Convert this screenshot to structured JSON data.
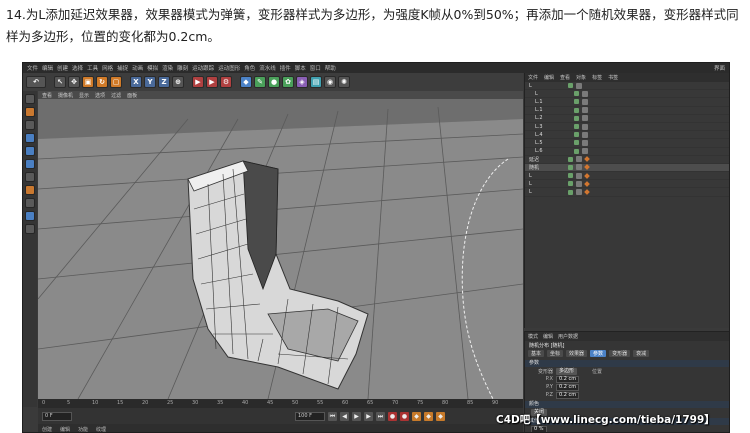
{
  "caption": "14.为L添加延迟效果器，效果器模式为弹簧，变形器样式为多边形，为强度K帧从0%到50%；再添加一个随机效果器，变形器样式同样为多边形，位置的变化都为0.2cm。",
  "menubar": {
    "items": [
      "文件",
      "编辑",
      "创建",
      "选择",
      "工具",
      "网格",
      "捕捉",
      "动画",
      "模拟",
      "渲染",
      "雕刻",
      "运动跟踪",
      "运动图形",
      "角色",
      "流水线",
      "插件",
      "脚本",
      "窗口",
      "帮助"
    ],
    "layout_label": "界面"
  },
  "toolbar": {
    "x_label": "X",
    "y_label": "Y",
    "z_label": "Z"
  },
  "viewport": {
    "menu": [
      "查看",
      "摄像机",
      "显示",
      "选项",
      "过滤",
      "面板"
    ]
  },
  "timeline": {
    "ticks": [
      "0",
      "5",
      "10",
      "15",
      "20",
      "25",
      "30",
      "35",
      "40",
      "45",
      "50",
      "55",
      "60",
      "65",
      "70",
      "75",
      "80",
      "85",
      "90"
    ],
    "start_frame": "0 F",
    "end_frame": "100 F",
    "material_menu": [
      "创建",
      "编辑",
      "功能",
      "纹理"
    ]
  },
  "objects": {
    "tabs": [
      "文件",
      "编辑",
      "查看",
      "对象",
      "标签",
      "书签"
    ],
    "rows": [
      {
        "name": "L"
      },
      {
        "name": "L"
      },
      {
        "name": "L.1"
      },
      {
        "name": "L.1"
      },
      {
        "name": "L.2"
      },
      {
        "name": "L.3"
      },
      {
        "name": "L.4"
      },
      {
        "name": "L.5"
      },
      {
        "name": "L.6"
      },
      {
        "name": "延迟"
      },
      {
        "name": "随机"
      },
      {
        "name": "L"
      },
      {
        "name": "L"
      },
      {
        "name": "L"
      }
    ]
  },
  "attributes": {
    "tabs": [
      "模式",
      "编辑",
      "用户数据"
    ],
    "object_label": "随机分布 [随机]",
    "subtabs": [
      "基本",
      "坐标",
      "效果器",
      "参数",
      "变形器",
      "衰减"
    ],
    "active_subtab": "参数",
    "section_effector": "参数",
    "mode_label": "变形器",
    "mode_value": "多边形",
    "position_label": "位置",
    "p_x": "0.2 cm",
    "p_y": "0.2 cm",
    "p_z": "0.2 cm",
    "section_color": "颜色",
    "color_mode": "关闭",
    "section_other": "其他",
    "strength": "0 %"
  },
  "watermark": "C4D吧【www.linecg.com/tieba/1799】"
}
